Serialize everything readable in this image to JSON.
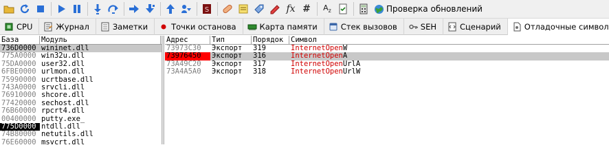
{
  "toolbar": {
    "buttons": [
      {
        "icon": "open-folder-icon"
      },
      {
        "icon": "restart-icon"
      },
      {
        "icon": "stop-icon"
      },
      {
        "icon": "run-icon"
      },
      {
        "icon": "pause-icon"
      },
      {
        "icon": "step-into-icon"
      },
      {
        "icon": "step-over-icon"
      },
      {
        "icon": "trace-into-icon"
      },
      {
        "icon": "trace-over-icon"
      },
      {
        "icon": "execute-till-return-icon"
      },
      {
        "icon": "execute-user-code-icon"
      },
      {
        "icon": "scylla-icon"
      },
      {
        "icon": "patch-icon"
      },
      {
        "icon": "comments-icon"
      },
      {
        "icon": "labels-icon"
      },
      {
        "icon": "bookmarks-icon"
      },
      {
        "icon": "functions-icon"
      },
      {
        "icon": "variables-icon"
      },
      {
        "icon": "strings-icon"
      },
      {
        "icon": "calculator-icon"
      }
    ],
    "functions_glyph": "fx",
    "hash_glyph": "#",
    "az_glyph": "A",
    "az_sub": "z",
    "check_updates_label": "Проверка обновлений"
  },
  "tabs": [
    {
      "label": "CPU",
      "icon": "cpu-icon"
    },
    {
      "label": "Журнал",
      "icon": "log-icon"
    },
    {
      "label": "Заметки",
      "icon": "notes-icon"
    },
    {
      "label": "Точки останова",
      "icon": "breakpoint-icon"
    },
    {
      "label": "Карта памяти",
      "icon": "memory-map-icon"
    },
    {
      "label": "Стек вызовов",
      "icon": "call-stack-icon"
    },
    {
      "label": "SEH",
      "icon": "seh-icon"
    },
    {
      "label": "Сценарий",
      "icon": "script-icon"
    },
    {
      "label": "Отладочные символы",
      "icon": "symbols-icon",
      "active": true
    }
  ],
  "modules": {
    "headers": [
      "База",
      "Модуль"
    ],
    "rows": [
      {
        "base": "736D0000",
        "module": "wininet.dll",
        "selected": true
      },
      {
        "base": "775A0000",
        "module": "win32u.dll"
      },
      {
        "base": "75DA0000",
        "module": "user32.dll"
      },
      {
        "base": "6FBE0000",
        "module": "urlmon.dll"
      },
      {
        "base": "75990000",
        "module": "ucrtbase.dll"
      },
      {
        "base": "743A0000",
        "module": "srvcli.dll"
      },
      {
        "base": "76910000",
        "module": "shcore.dll"
      },
      {
        "base": "77420000",
        "module": "sechost.dll"
      },
      {
        "base": "76B60000",
        "module": "rpcrt4.dll"
      },
      {
        "base": "00400000",
        "module": "putty.exe_"
      },
      {
        "base": "775D0000",
        "module": "ntdll.dll",
        "base_highlight": true
      },
      {
        "base": "74B80000",
        "module": "netutils.dll"
      },
      {
        "base": "76E60000",
        "module": "msvcrt.dll"
      }
    ]
  },
  "symbols": {
    "headers": [
      "Адрес",
      "Тип",
      "Порядок",
      "Символ"
    ],
    "rows": [
      {
        "address": "73973C30",
        "type": "Экспорт",
        "ordinal": "319",
        "sym_prefix": "InternetOpen",
        "sym_suffix": "W"
      },
      {
        "address": "73976450",
        "type": "Экспорт",
        "ordinal": "316",
        "sym_prefix": "InternetOpen",
        "sym_suffix": "A",
        "selected": true,
        "address_highlight": true
      },
      {
        "address": "73A49C20",
        "type": "Экспорт",
        "ordinal": "317",
        "sym_prefix": "InternetOpen",
        "sym_suffix": "UrlA"
      },
      {
        "address": "73A4A5A0",
        "type": "Экспорт",
        "ordinal": "318",
        "sym_prefix": "InternetOpen",
        "sym_suffix": "UrlW"
      }
    ]
  },
  "colors": {
    "search_match": "#d00000",
    "address_highlight": "#ff0000",
    "base_highlight": "#000000",
    "selected_row": "#c8c8c8"
  }
}
